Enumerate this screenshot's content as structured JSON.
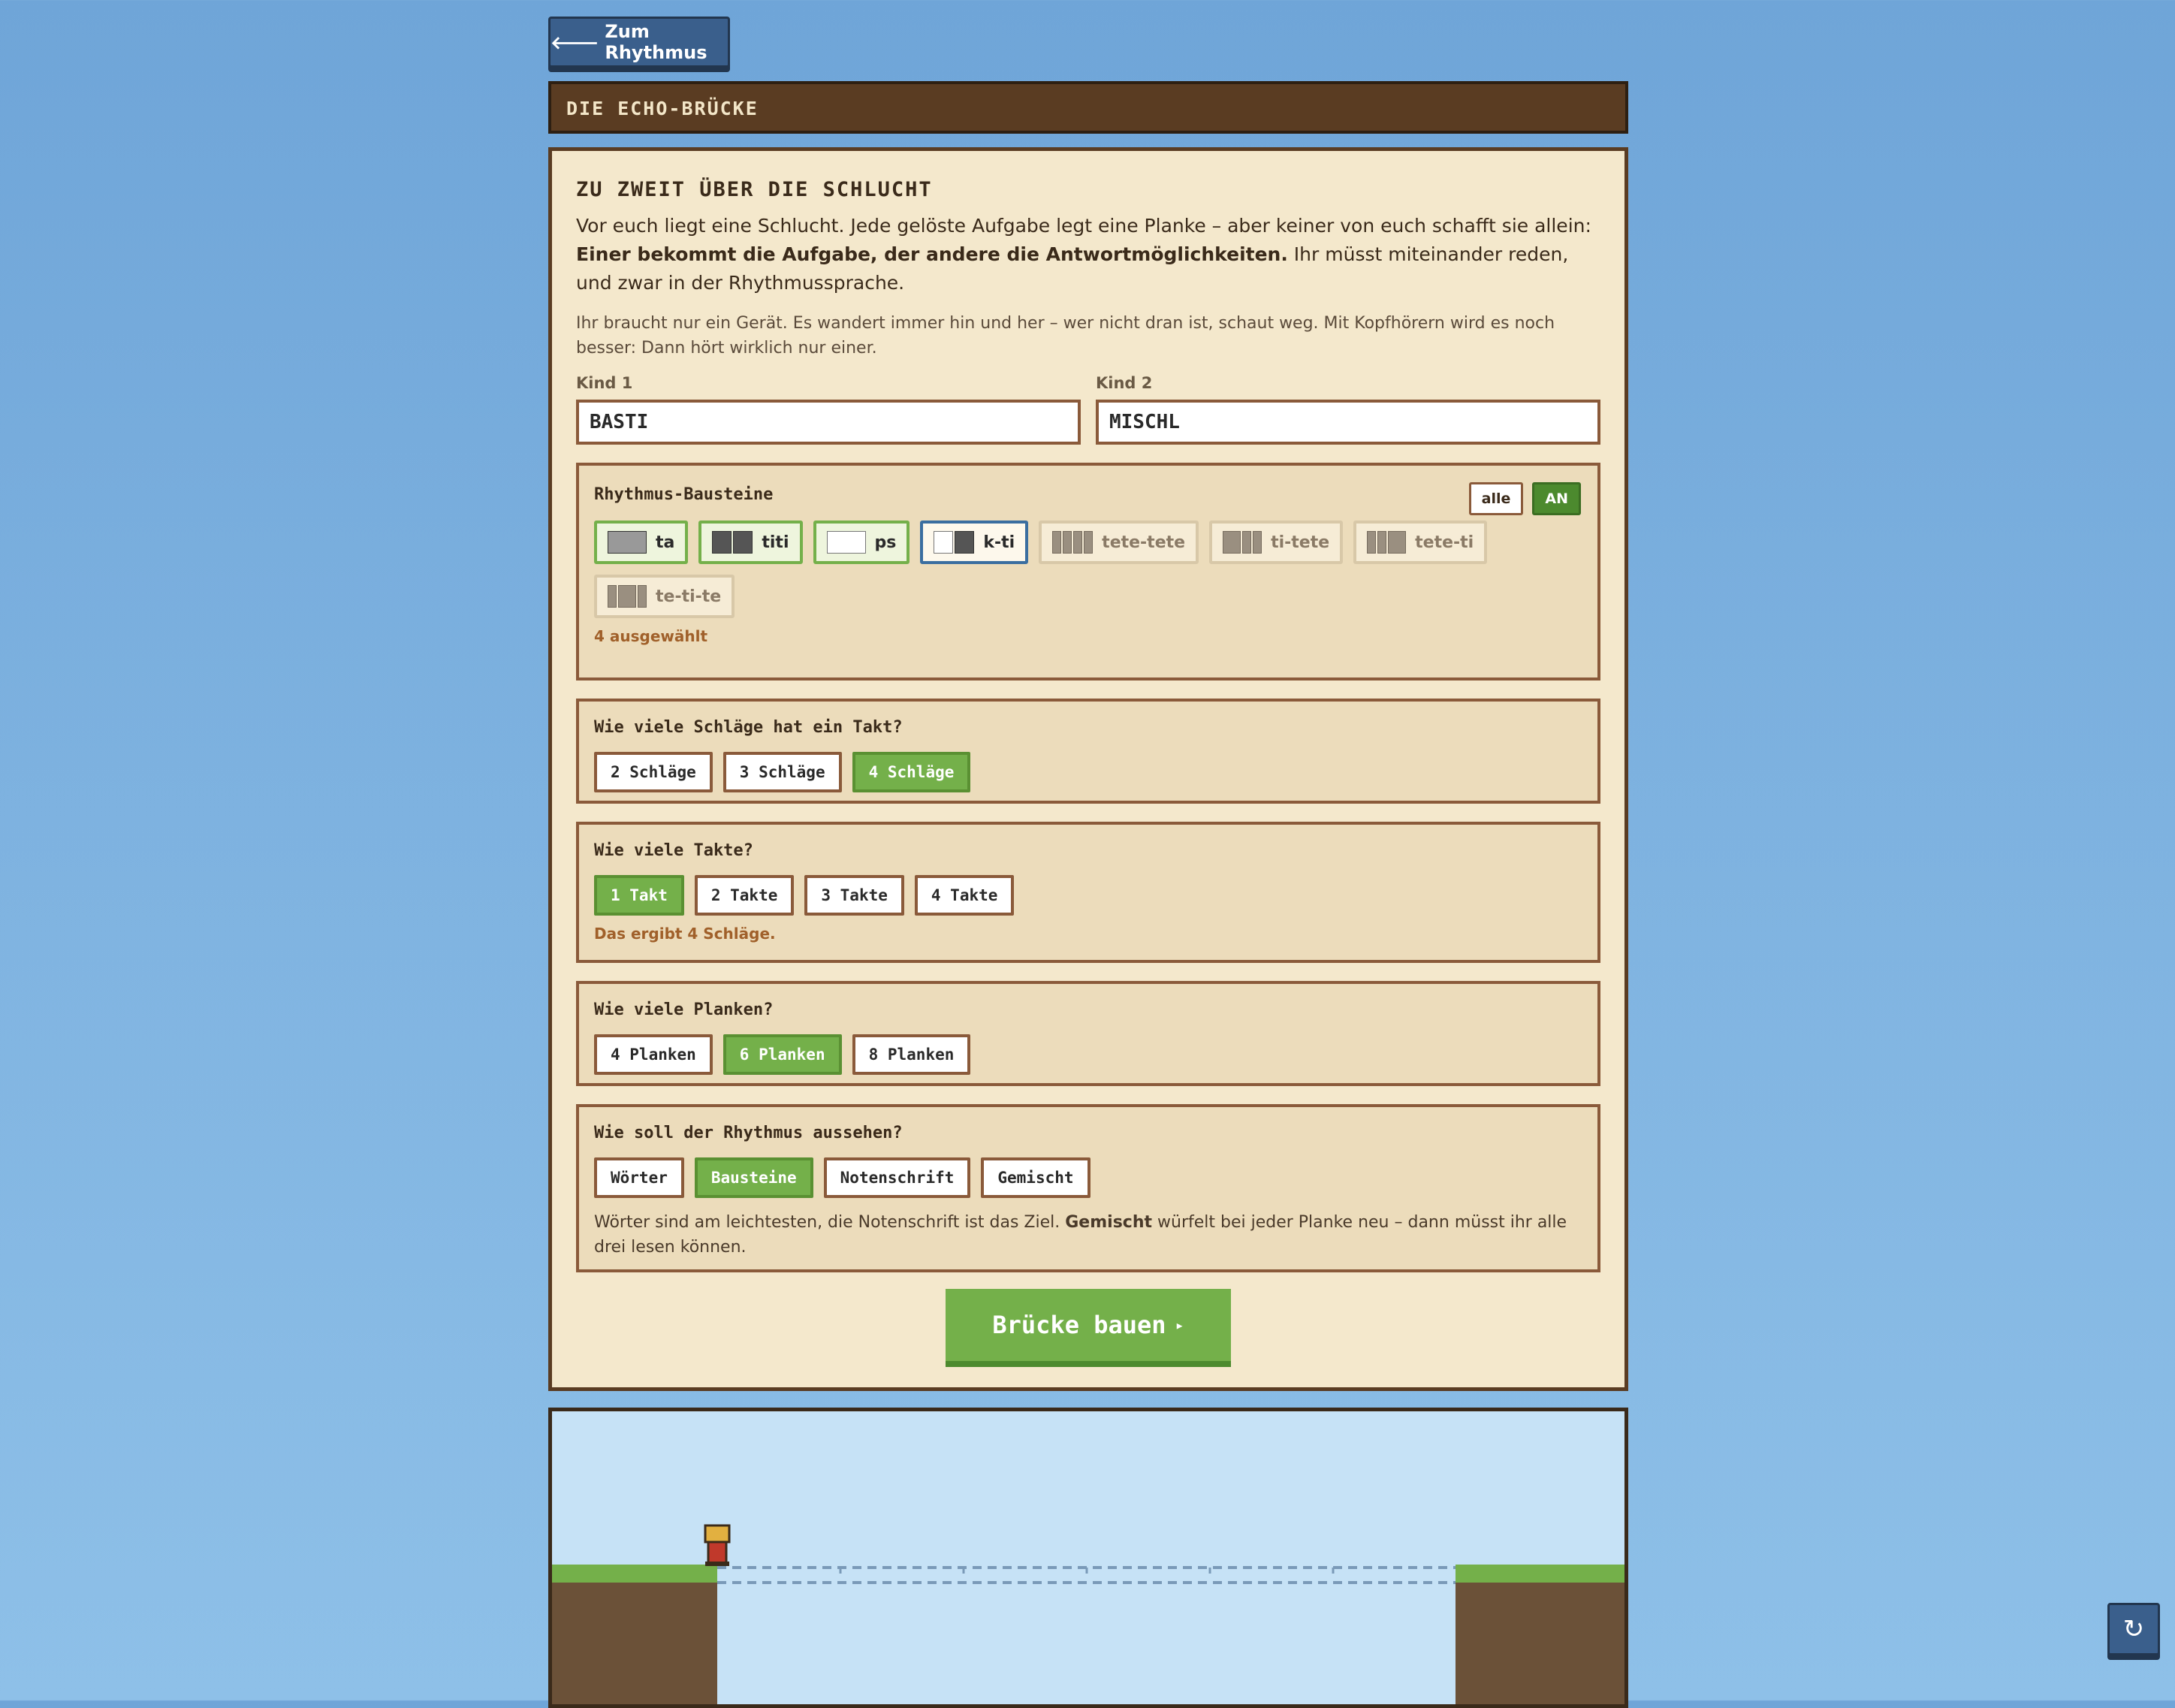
{
  "nav": {
    "back_label": "Zum Rhythmus",
    "back_icon": "arrow-left-icon"
  },
  "title": "DIE ECHO-BRÜCKE",
  "setup": {
    "heading": "ZU ZWEIT ÜBER DIE SCHLUCHT",
    "intro_a": "Vor euch liegt eine Schlucht. Jede gelöste Aufgabe legt eine Planke – aber keiner von euch schafft sie allein: ",
    "intro_bold": "Einer bekommt die Aufgabe, der andere die Antwortmöglichkeiten.",
    "intro_b": " Ihr müsst miteinander reden, und zwar in der Rhythmussprache.",
    "sub": "Ihr braucht nur ein Gerät. Es wandert immer hin und her – wer nicht dran ist, schaut weg. Mit Kopfhörern wird es noch besser: Dann hört wirklich nur einer.",
    "kid1_label": "Kind 1",
    "kid1_value": "BASTI",
    "kid2_label": "Kind 2",
    "kid2_value": "MISCHL"
  },
  "blocks": {
    "title": "Rhythmus-Bausteine",
    "all_label": "alle",
    "toggle_label": "AN",
    "items": [
      {
        "label": "ta",
        "state": "selected"
      },
      {
        "label": "titi",
        "state": "selected"
      },
      {
        "label": "ps",
        "state": "selected"
      },
      {
        "label": "k-ti",
        "state": "selected-focus"
      },
      {
        "label": "tete-tete",
        "state": "off"
      },
      {
        "label": "ti-tete",
        "state": "off"
      },
      {
        "label": "tete-ti",
        "state": "off"
      },
      {
        "label": "te-ti-te",
        "state": "off"
      }
    ],
    "count_text": "4 ausgewählt"
  },
  "beats": {
    "question": "Wie viele Schläge hat ein Takt?",
    "options": [
      "2 Schläge",
      "3 Schläge",
      "4 Schläge"
    ],
    "selected": 2
  },
  "measures": {
    "question": "Wie viele Takte?",
    "options": [
      "1 Takt",
      "2 Takte",
      "3 Takte",
      "4 Takte"
    ],
    "selected": 0,
    "note": "Das ergibt 4 Schläge."
  },
  "planks": {
    "question": "Wie viele Planken?",
    "options": [
      "4 Planken",
      "6 Planken",
      "8 Planken"
    ],
    "selected": 1
  },
  "display": {
    "question": "Wie soll der Rhythmus aussehen?",
    "options": [
      "Wörter",
      "Bausteine",
      "Notenschrift",
      "Gemischt"
    ],
    "selected": 1,
    "hint_a": "Wörter sind am leichtesten, die Notenschrift ist das Ziel. ",
    "hint_bold": "Gemischt",
    "hint_b": " würfelt bei jeder Planke neu – dann müsst ihr alle drei lesen können."
  },
  "build_label": "Brücke bauen",
  "reload_icon": "reload-icon",
  "colors": {
    "accent_green": "#74b04a",
    "wood": "#5a3c22",
    "sky": "#c6e2f6"
  }
}
